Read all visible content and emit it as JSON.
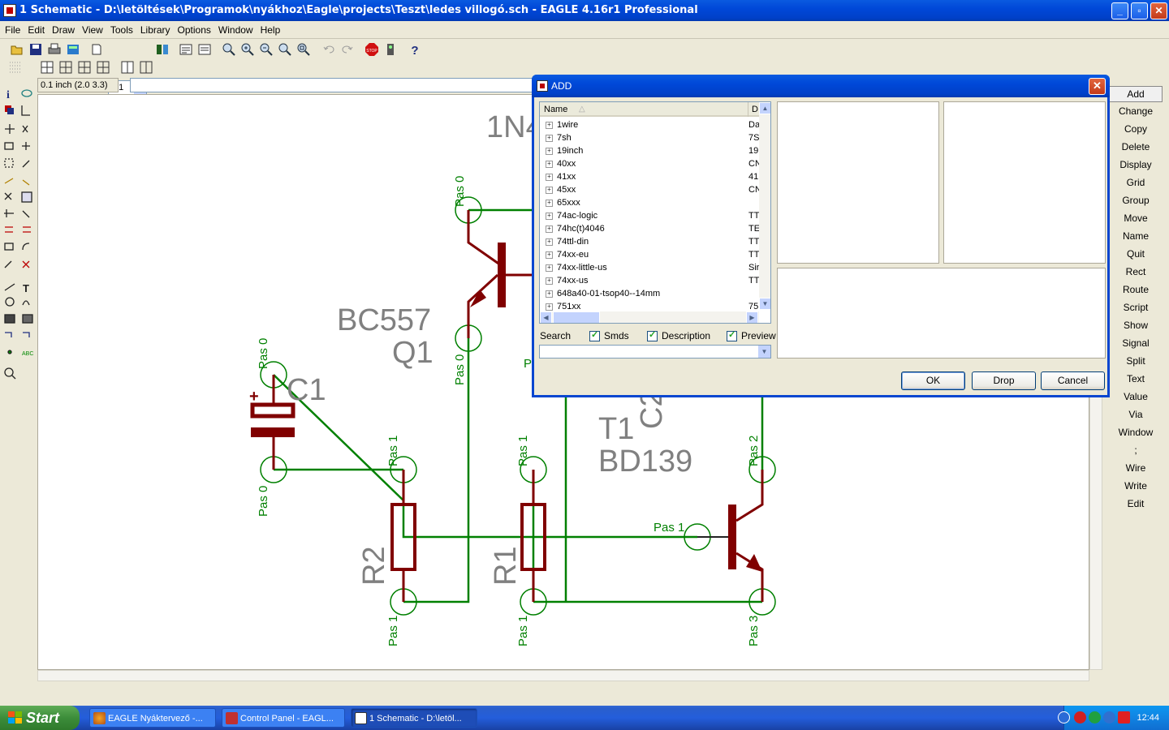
{
  "window": {
    "title": "1 Schematic - D:\\letöltések\\Programok\\nyákhoz\\Eagle\\projects\\Teszt\\ledes villogó.sch - EAGLE 4.16r1 Professional",
    "min": "_",
    "max": "▫",
    "close": "✕"
  },
  "menu": [
    "File",
    "Edit",
    "Draw",
    "View",
    "Tools",
    "Library",
    "Options",
    "Window",
    "Help"
  ],
  "toolbar": {
    "sheet_select": "1/1"
  },
  "coord": {
    "grid_readout": "0.1 inch (2.0 3.3)",
    "command_value": ""
  },
  "right_commands": [
    "Add",
    "Change",
    "Copy",
    "Delete",
    "Display",
    "Grid",
    "Group",
    "Move",
    "Name",
    "Quit",
    "Rect",
    "Route",
    "Script",
    "Show",
    "Signal",
    "Split",
    "Text",
    "Value",
    "Via",
    "Window",
    ";",
    "Wire",
    "Write",
    "Edit"
  ],
  "schematic": {
    "labels": {
      "n1": "1N4",
      "bc557": "BC557",
      "q1": "Q1",
      "c1": "C1",
      "t1": "T1",
      "bd139": "BD139",
      "c2": "C2",
      "r1": "R1",
      "r2": "R2",
      "plus": "+"
    },
    "pins": {
      "q1_top": "Pas 0",
      "q1_bottom": "Pas 0",
      "c1_top": "Pas 0",
      "c1_bottom": "Pas 0",
      "r2_top": "Pas 1",
      "r2_bottom": "Pas 1",
      "r1_top": "Pas 1",
      "r1_bottom": "Pas 1",
      "t1_base": "Pas 1",
      "t1_top": "Pas 2",
      "t1_bottom": "Pas 3",
      "hidden_p": "P"
    },
    "colors": {
      "wire": "#008000",
      "symbol": "#800000",
      "label": "#808080",
      "pin_label": "#008000"
    }
  },
  "add_dialog": {
    "title": "ADD",
    "close": "✕",
    "col_name": "Name",
    "col_desc": "D",
    "libraries": [
      {
        "name": "1wire",
        "desc": "Da"
      },
      {
        "name": "7sh",
        "desc": "7S"
      },
      {
        "name": "19inch",
        "desc": "19"
      },
      {
        "name": "40xx",
        "desc": "CN"
      },
      {
        "name": "41xx",
        "desc": "41"
      },
      {
        "name": "45xx",
        "desc": "CN"
      },
      {
        "name": "65xxx",
        "desc": ""
      },
      {
        "name": "74ac-logic",
        "desc": "TT"
      },
      {
        "name": "74hc(t)4046",
        "desc": "TE"
      },
      {
        "name": "74ttl-din",
        "desc": "TT"
      },
      {
        "name": "74xx-eu",
        "desc": "TT"
      },
      {
        "name": "74xx-little-us",
        "desc": "Sir"
      },
      {
        "name": "74xx-us",
        "desc": "TT"
      },
      {
        "name": "648a40-01-tsop40--14mm",
        "desc": ""
      },
      {
        "name": "751xx",
        "desc": "75"
      }
    ],
    "search_label": "Search",
    "search_value": "",
    "checks": {
      "smds": "Smds",
      "description": "Description",
      "preview": "Preview"
    },
    "buttons": {
      "ok": "OK",
      "drop": "Drop",
      "cancel": "Cancel"
    }
  },
  "taskbar": {
    "start": "Start",
    "tasks": [
      {
        "label": "EAGLE Nyáktervező -..."
      },
      {
        "label": "Control Panel - EAGL..."
      },
      {
        "label": "1 Schematic - D:\\letöl..."
      }
    ],
    "clock": "12:44"
  }
}
